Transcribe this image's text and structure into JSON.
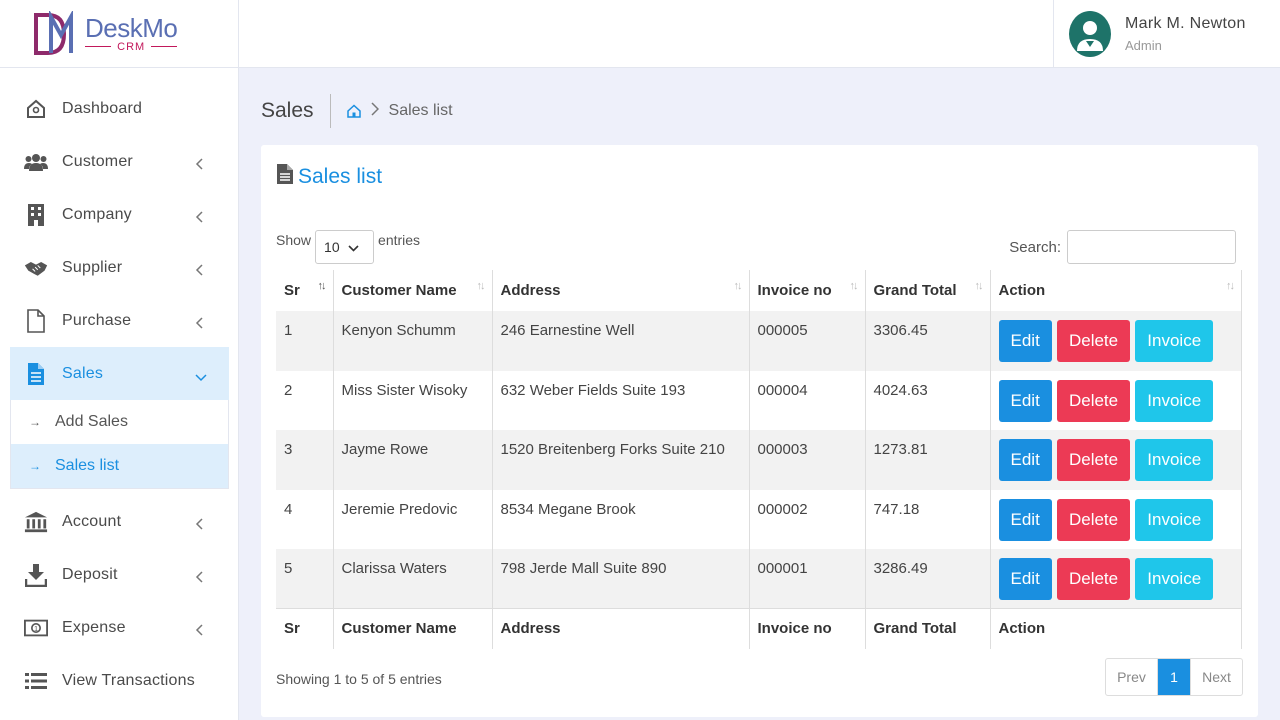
{
  "brand": {
    "name": "DeskMo",
    "sub": "CRM"
  },
  "user": {
    "name": "Mark M. Newton",
    "role": "Admin"
  },
  "sidebar": {
    "items": [
      {
        "label": "Dashboard",
        "icon": "home-icon"
      },
      {
        "label": "Customer",
        "icon": "users-icon"
      },
      {
        "label": "Company",
        "icon": "building-icon"
      },
      {
        "label": "Supplier",
        "icon": "handshake-icon"
      },
      {
        "label": "Purchase",
        "icon": "file-icon"
      },
      {
        "label": "Sales",
        "icon": "document-icon"
      }
    ],
    "sales_sub": [
      {
        "label": "Add Sales"
      },
      {
        "label": "Sales list"
      }
    ],
    "items_after": [
      {
        "label": "Account",
        "icon": "bank-icon"
      },
      {
        "label": "Deposit",
        "icon": "download-icon"
      },
      {
        "label": "Expense",
        "icon": "money-icon"
      },
      {
        "label": "View Transactions",
        "icon": "list-icon"
      }
    ]
  },
  "breadcrumb": {
    "title": "Sales",
    "current": "Sales list"
  },
  "card": {
    "title": "Sales list"
  },
  "controls": {
    "show_label": "Show",
    "entries_value": "10",
    "entries_label": "entries",
    "search_label": "Search:",
    "search_value": ""
  },
  "table": {
    "headers": [
      "Sr",
      "Customer Name",
      "Address",
      "Invoice no",
      "Grand Total",
      "Action"
    ],
    "rows": [
      [
        "1",
        "Kenyon Schumm",
        "246 Earnestine Well",
        "000005",
        "3306.45"
      ],
      [
        "2",
        "Miss Sister Wisoky",
        "632 Weber Fields Suite 193",
        "000004",
        "4024.63"
      ],
      [
        "3",
        "Jayme Rowe",
        "1520 Breitenberg Forks Suite 210",
        "000003",
        "1273.81"
      ],
      [
        "4",
        "Jeremie Predovic",
        "8534 Megane Brook",
        "000002",
        "747.18"
      ],
      [
        "5",
        "Clarissa Waters",
        "798 Jerde Mall Suite 890",
        "000001",
        "3286.49"
      ]
    ],
    "actions": {
      "edit": "Edit",
      "delete": "Delete",
      "invoice": "Invoice"
    }
  },
  "footer": {
    "info": "Showing 1 to 5 of 5 entries",
    "prev": "Prev",
    "page": "1",
    "next": "Next"
  },
  "colors": {
    "primary": "#1a8fe0",
    "danger": "#ec3a55",
    "info": "#1fc6ea",
    "avatar": "#1e7369"
  }
}
